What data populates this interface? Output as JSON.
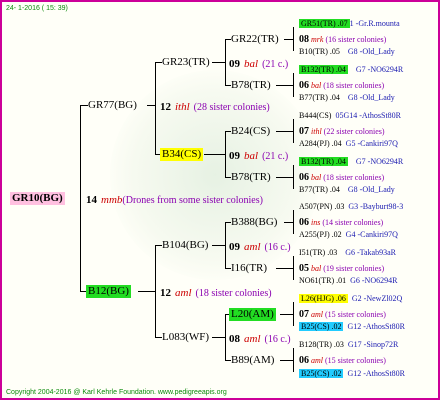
{
  "header": "24-  1-2016 ( 15: 39)",
  "footer": "Copyright 2004-2016 @ Karl Kehrle Foundation.   www.pedigreeapis.org",
  "root": {
    "name": "GR10(BG)",
    "gen_num": "14",
    "gen_name": "mmb",
    "note": "(Drones from some sister colonies)"
  },
  "g1": [
    {
      "name": "GR77(BG)",
      "gen_num": "",
      "gen_name": "",
      "note": ""
    },
    {
      "name": "B12(BG)",
      "gen_num": "12",
      "gen_name": "aml",
      "note": "(18 sister colonies)"
    }
  ],
  "g2": [
    {
      "name": "GR23(TR)",
      "gen_num": "12",
      "gen_name": "ithl",
      "note": "(28 sister colonies)"
    },
    {
      "name": "B34(CS)"
    },
    {
      "name": "B104(BG)",
      "gen_num": "09",
      "gen_name": "aml",
      "note": "(16 c.)"
    },
    {
      "name": "L083(WF)",
      "gen_num": "08",
      "gen_name": "aml",
      "note": "(16 c.)"
    }
  ],
  "g3": [
    {
      "name": "GR22(TR)",
      "gen_num": "09",
      "gen_name": "bal",
      "note": "(21 c.)"
    },
    {
      "name": "B78(TR)"
    },
    {
      "name": "B24(CS)",
      "gen_num": "09",
      "gen_name": "bal",
      "note": "(21 c.)"
    },
    {
      "name": "B78(TR)"
    },
    {
      "name": "B388(BG)",
      "gen_num": "09",
      "gen_name": "aml",
      "note": "(16 c.)"
    },
    {
      "name": "I16(TR)"
    },
    {
      "name": "L20(AM)",
      "gen_num": "08",
      "gen_name": "aml",
      "note": "(16 c.)"
    },
    {
      "name": "B89(AM)"
    }
  ],
  "g4": [
    {
      "top": "GR51(TR) .07",
      "top_tail": "1 -Gr.R.mounta",
      "mid_num": "08",
      "mid_name": "mrk",
      "mid_note": "(16 sister colonies)",
      "bot": "B10(TR) .05",
      "bot_tail": "G8 -Old_Lady"
    },
    {
      "top": "B132(TR) .04",
      "top_tail": "G7 -NO6294R",
      "mid_num": "06",
      "mid_name": "bal",
      "mid_note": "(18 sister colonies)",
      "bot": "B77(TR) .04",
      "bot_tail": "G8 -Old_Lady"
    },
    {
      "top": "B444(CS)",
      "top_tail": "05G14 -AthosSt80R",
      "mid_num": "07",
      "mid_name": "ithl",
      "mid_note": "(22 sister colonies)",
      "bot": "A284(PJ) .04",
      "bot_tail": "G5 -Cankiri97Q"
    },
    {
      "top": "B132(TR) .04",
      "top_tail": "G7 -NO6294R",
      "mid_num": "06",
      "mid_name": "bal",
      "mid_note": "(18 sister colonies)",
      "bot": "B77(TR) .04",
      "bot_tail": "G8 -Old_Lady"
    },
    {
      "top": "A507(PN) .03",
      "top_tail": "G3 -Bayburt98-3",
      "mid_num": "06",
      "mid_name": "ins",
      "mid_note": "(14 sister colonies)",
      "bot": "A255(PJ) .02",
      "bot_tail": "G4 -Cankiri97Q"
    },
    {
      "top": "I51(TR) .03",
      "top_tail": "G6 -Takab93aR",
      "mid_num": "05",
      "mid_name": "bal",
      "mid_note": "(19 sister colonies)",
      "bot": "NO61(TR) .01",
      "bot_tail": "G6 -NO6294R"
    },
    {
      "top": "L26(HJG) .06",
      "top_tail": "G2 -NewZl02Q",
      "mid_num": "07",
      "mid_name": "aml",
      "mid_note": "(15 sister colonies)",
      "bot": "B25(CS) .02",
      "bot_tail": "G12 -AthosSt80R"
    },
    {
      "top": "B128(TR) .03",
      "top_tail": "G17 -Sinop72R",
      "mid_num": "06",
      "mid_name": "aml",
      "mid_note": "(15 sister colonies)",
      "bot": "B25(CS) .02",
      "bot_tail": "G12 -AthosSt80R"
    }
  ]
}
